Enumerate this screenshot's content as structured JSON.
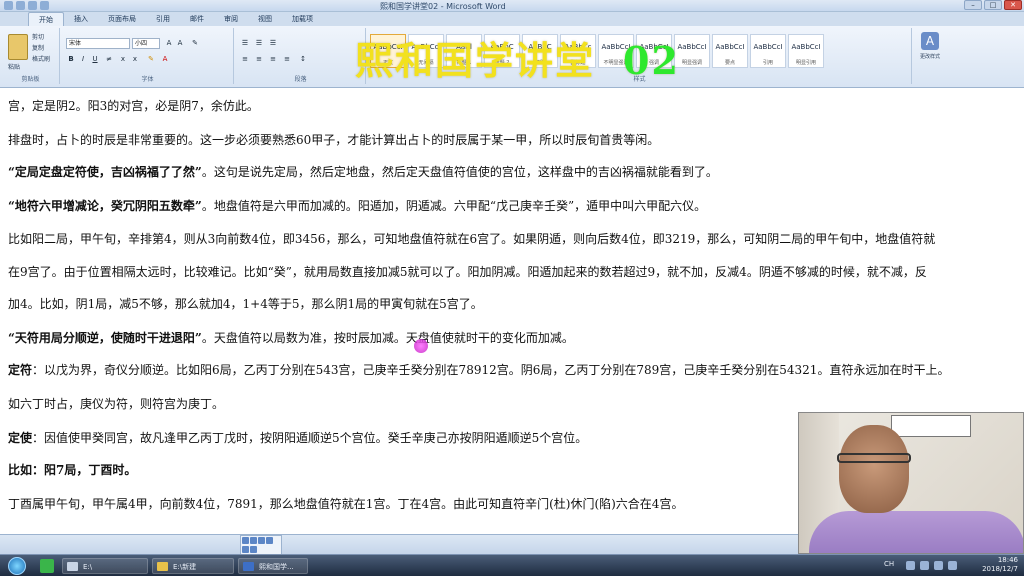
{
  "window": {
    "title": "熙和国学讲堂02 - Microsoft Word"
  },
  "ribbon": {
    "tabs": [
      {
        "label": "开始",
        "active": true
      },
      {
        "label": "插入"
      },
      {
        "label": "页面布局"
      },
      {
        "label": "引用"
      },
      {
        "label": "邮件"
      },
      {
        "label": "审阅"
      },
      {
        "label": "视图"
      },
      {
        "label": "加载项"
      }
    ],
    "clipboard": {
      "paste_label": "粘贴",
      "cut_label": "剪切",
      "copy_label": "复制",
      "painter_label": "格式刷",
      "group_label": "剪贴板"
    },
    "font": {
      "font_name": "宋体",
      "font_size": "小四",
      "group_label": "字体"
    },
    "paragraph": {
      "group_label": "段落"
    },
    "styles": {
      "items": [
        {
          "preview": "AaBbCcI",
          "name": "正文",
          "selected": true
        },
        {
          "preview": "AaBbCcI",
          "name": "无间隔"
        },
        {
          "preview": "AaBl",
          "name": "标题 1"
        },
        {
          "preview": "AaBbC",
          "name": "标题 2"
        },
        {
          "preview": "AaBbC",
          "name": "标题"
        },
        {
          "preview": "AaBbCc",
          "name": "副标题"
        },
        {
          "preview": "AaBbCcI",
          "name": "不明显强调"
        },
        {
          "preview": "AaBbCcI",
          "name": "强调"
        },
        {
          "preview": "AaBbCcI",
          "name": "明显强调"
        },
        {
          "preview": "AaBbCcI",
          "name": "要点"
        },
        {
          "preview": "AaBbCcI",
          "name": "引用"
        },
        {
          "preview": "AaBbCcI",
          "name": "明显引用"
        }
      ],
      "change_label": "更改样式",
      "group_label": "样式"
    }
  },
  "banner": {
    "text": "熙和国学讲堂",
    "number": "02"
  },
  "document": {
    "lines": [
      {
        "pre": "",
        "bold": "",
        "text": "宫，定是阴2。阳3的对宫，必是阴7，余仿此。"
      },
      {
        "pre": "",
        "bold": "",
        "text": "排盘时，占卜的时辰是非常重要的。这一步必须要熟悉60甲子，才能计算出占卜的时辰属于某一甲，所以时辰旬首贵等闲。"
      },
      {
        "pre": "",
        "bold": "“定局定盘定符使，吉凶祸福了了然”",
        "text": "。这句是说先定局，然后定地盘，然后定天盘值符值使的宫位，这样盘中的吉凶祸福就能看到了。"
      },
      {
        "pre": "",
        "bold": "“地符六甲增减论，癸冗阴阳五数牵”",
        "text": "。地盘值符是六甲而加减的。阳遁加，阴遁减。六甲配“戊己庚辛壬癸”，遁甲中叫六甲配六仪。"
      },
      {
        "pre": "",
        "bold": "",
        "text": "比如阳二局，甲午旬，辛排第4，则从3向前数4位，即3456，那么，可知地盘值符就在6宫了。如果阴遁，则向后数4位，即3219，那么，可知阴二局的甲午旬中，地盘值符就"
      },
      {
        "pre": "",
        "bold": "",
        "text": "在9宫了。由于位置相隔太远时，比较难记。比如“癸”，就用局数直接加减5就可以了。阳加阴减。阳遁加起来的数若超过9，就不加，反减4。阴遁不够减的时候，就不减，反"
      },
      {
        "pre": "",
        "bold": "",
        "text": "加4。比如，阴1局，减5不够，那么就加4，1+4等于5，那么阴1局的甲寅旬就在5宫了。"
      },
      {
        "pre": "",
        "bold": "“天符用局分顺逆，使随时干进退阳”",
        "text": "。天盘值符以局数为准，按时辰加减。天盘值使就时干的变化而加减。"
      },
      {
        "pre": "",
        "bold": "定符",
        "text": "：以戊为界，奇仪分顺逆。比如阳6局，乙丙丁分别在543宫，己庚辛壬癸分别在78912宫。阴6局，乙丙丁分别在789宫，己庚辛壬癸分别在54321。直符永远加在时干上。"
      },
      {
        "pre": "",
        "bold": "",
        "text": "如六丁时占，庚仪为符，则符宫为庚丁。"
      },
      {
        "pre": "",
        "bold": "定使",
        "text": "：因值使甲癸同宫，故凡逢甲乙丙丁戊时，按阴阳遁顺逆5个宫位。癸壬辛庚己亦按阴阳遁顺逆5个宫位。"
      },
      {
        "pre": "",
        "bold": "比如：阳7局，丁酉时。",
        "text": ""
      },
      {
        "pre": "        ",
        "bold": "",
        "text": "丁酉属甲午旬，甲午属4甲，向前数4位，7891，那么地盘值符就在1宫。丁在4宫。由此可知直符辛门(杜)休门(陷)六合在4宫。"
      }
    ],
    "highlight_text": "按时辰加减"
  },
  "taskbar": {
    "items": [
      {
        "label": "E:\\",
        "color": "#c9d5e6"
      },
      {
        "label": "E:\\新建",
        "color": "#e8c14a"
      },
      {
        "label": "熙和国学...",
        "color": "#3d6fc6"
      }
    ],
    "lang": "CH",
    "time": "18:46",
    "date": "2018/12/7"
  }
}
